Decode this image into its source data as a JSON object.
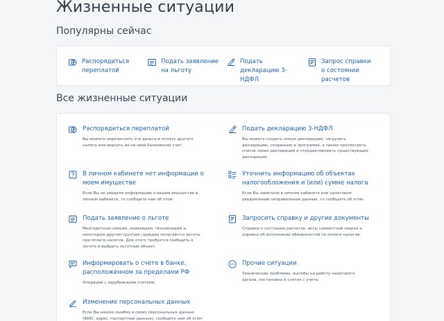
{
  "page": {
    "title": "Жизненные ситуации"
  },
  "popular": {
    "title": "Популярны сейчас",
    "items": [
      {
        "label": "Распорядиться переплатой",
        "icon": "ruble-coin-icon"
      },
      {
        "label": "Подать заявление на льготу",
        "icon": "document-list-icon"
      },
      {
        "label": "Подать декларацию 3-НДФЛ",
        "icon": "declaration-icon"
      },
      {
        "label": "Запрос справки о состоянии расчетов",
        "icon": "certificate-icon"
      }
    ]
  },
  "all": {
    "title": "Все жизненные ситуации",
    "items": [
      {
        "title": "Распорядиться переплатой",
        "desc": "Вы можете перечислить эти деньги в оплату другого налога или вернуть их на свой банковский счет.",
        "icon": "ruble-coin-icon"
      },
      {
        "title": "Подать декларацию 3-НДФЛ",
        "desc": "Вы можете создать новую декларацию, загрузить декларацию, созданную в программе, а также просмотреть список своих деклараций и отредактировать существующие декларации.",
        "icon": "declaration-icon"
      },
      {
        "title": "В личном кабинете нет информации о моем имуществе",
        "desc": "Если Вы не увидели информацию о вашем имуществе в личном кабинете, то сообщите нам об этом.",
        "icon": "question-icon"
      },
      {
        "title": "Уточнить информацию об объектах налогообложения и (или) сумме налога",
        "desc": "Если Вы заметили в личном кабинете или налоговом уведомлении неправильные данные, то сообщите об этом.",
        "icon": "checklist-icon"
      },
      {
        "title": "Подать заявление о льготе",
        "desc": "Многодетным семьям, инвалидам, пенсионерам и некоторым другим группам граждан полагаются льготы при оплате налогов. Для этого требуется сообщить о льготе и выбрать льготный объект.",
        "icon": "document-list-icon"
      },
      {
        "title": "Запросить справку и другие документы",
        "desc": "Справки о состоянии расчетов, акты совместной сверки и справки об исполнении обязанностей по оплате налогов.",
        "icon": "certificate-icon"
      },
      {
        "title": "Информировать о счете в банке, расположенном за пределами РФ",
        "desc": "Операции с зарубежными счетами.",
        "icon": "chat-icon"
      },
      {
        "title": "Прочие ситуации",
        "desc": "Технические проблемы, жалобы на работу налогового органа, постановка и снятие с учета.",
        "icon": "more-icon"
      },
      {
        "title": "Изменение персональных данных",
        "desc": "Если Вы нашли ошибку в своих персональных данных (ФИО, адрес, паспортные данные), сообщите нам об этом.",
        "icon": "pencil-icon"
      }
    ]
  },
  "colors": {
    "accent": "#1f5fa8",
    "text": "#2b3a4a",
    "background": "#f4f5f7",
    "card": "#ffffff"
  }
}
